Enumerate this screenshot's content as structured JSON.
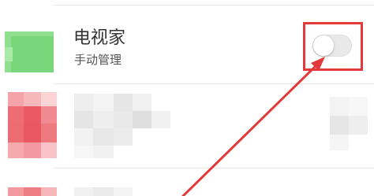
{
  "app_list": {
    "items": [
      {
        "name": "电视家",
        "subtitle": "手动管理",
        "toggle_on": false,
        "icon_color": "#7cd87c"
      }
    ]
  },
  "annotation": {
    "color": "#e23a3a"
  }
}
